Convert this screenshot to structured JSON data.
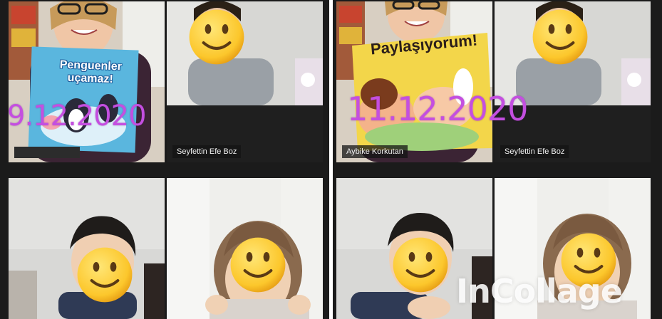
{
  "panels": [
    {
      "date": "9.12.2020",
      "book_title_line1": "Penguenler",
      "book_title_line2": "uçamaz!",
      "tiles": [
        {
          "name": ""
        },
        {
          "name": "Seyfettin Efe Boz"
        },
        {
          "name": ""
        },
        {
          "name": ""
        }
      ]
    },
    {
      "date": "11.12.2020",
      "book_title": "Paylaşıyorum!",
      "tiles": [
        {
          "name": "Aybike Korkutan"
        },
        {
          "name": "Seyfettin Efe Boz"
        },
        {
          "name": ""
        },
        {
          "name": ""
        }
      ]
    }
  ],
  "watermark": "InCollage",
  "colors": {
    "date_text": "#c44fe0",
    "active_speaker_border": "#2ad15a",
    "zoom_background": "#1b1b1b"
  },
  "icons": [
    "smiley-face-icon"
  ]
}
